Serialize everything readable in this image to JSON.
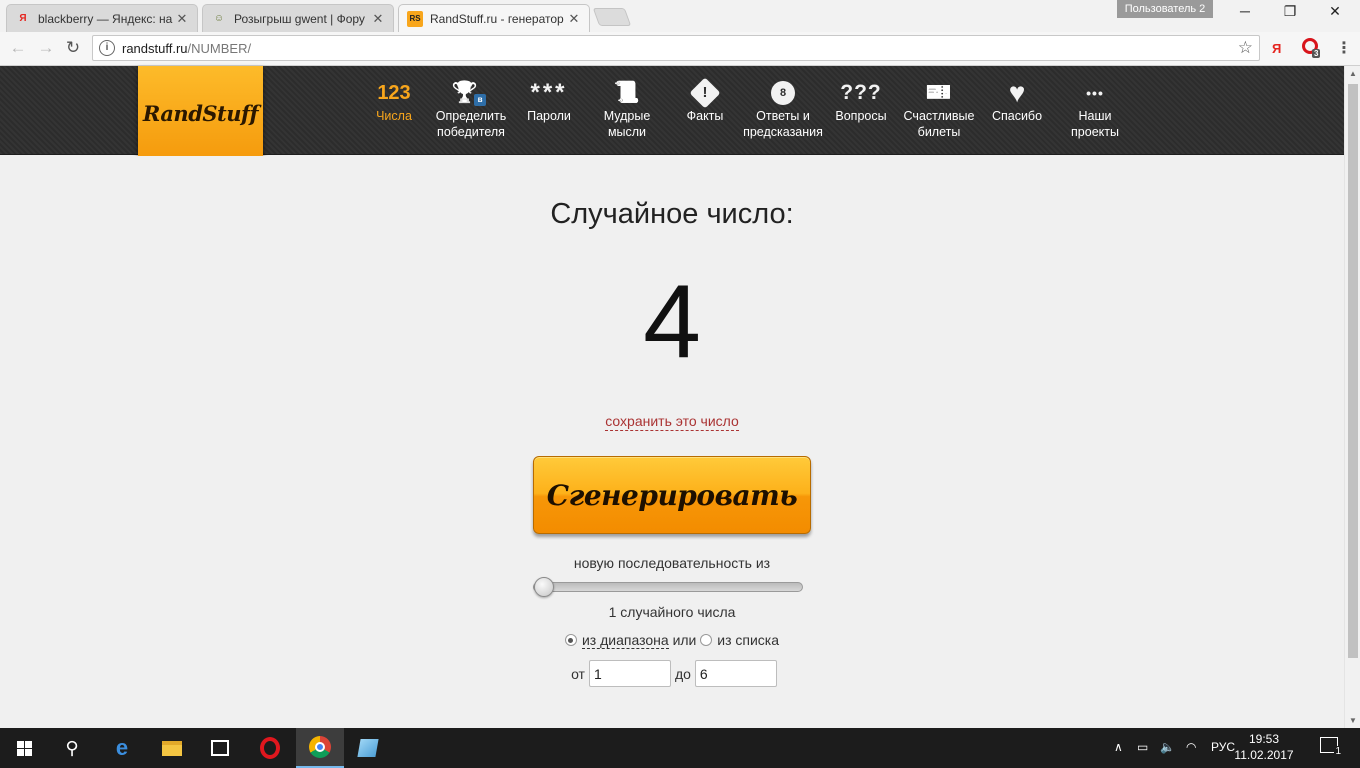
{
  "browser": {
    "tabs": [
      {
        "title": "blackberry — Яндекс: на",
        "favicon": "Я",
        "favicon_color": "#e52620"
      },
      {
        "title": "Розыгрыш gwent | Фору",
        "favicon": "☺",
        "favicon_color": "#6b7b3a"
      },
      {
        "title": "RandStuff.ru - генератор",
        "favicon": "RS",
        "favicon_color": "#f8a61c"
      }
    ],
    "user_badge": "Пользователь 2",
    "url_host": "randstuff.ru",
    "url_path": "/NUMBER/",
    "ext_badge": "3"
  },
  "site": {
    "logo": "RandStuff",
    "nav": [
      {
        "icon": "123",
        "label": "Числа",
        "active": true
      },
      {
        "icon": "🏆",
        "label": "Определить победителя",
        "active": false
      },
      {
        "icon": "***",
        "label": "Пароли",
        "active": false
      },
      {
        "icon": "📜",
        "label": "Мудрые мысли",
        "active": false
      },
      {
        "icon": "❗",
        "label": "Факты",
        "active": false
      },
      {
        "icon": "8",
        "label": "Ответы и предсказания",
        "active": false
      },
      {
        "icon": "???",
        "label": "Вопросы",
        "active": false
      },
      {
        "icon": "🎫",
        "label": "Счастливые билеты",
        "active": false
      },
      {
        "icon": "♥",
        "label": "Спасибо",
        "active": false
      },
      {
        "icon": "•••",
        "label": "Наши проекты",
        "active": false
      }
    ],
    "accent_color": "#f8a61c"
  },
  "main": {
    "title": "Случайное число:",
    "number": "4",
    "save_link": "сохранить это число",
    "generate_button": "Сгенерировать",
    "sequence_label": "новую последовательность из",
    "count_label": "1 случайного числа",
    "slider_value": 1,
    "mode_range": "из диапазона",
    "mode_or": "или",
    "mode_list": "из списка",
    "from_label": "от",
    "from_value": "1",
    "to_label": "до",
    "to_value": "6"
  },
  "taskbar": {
    "lang": "РУС",
    "time": "19:53",
    "date": "11.02.2017",
    "notifications": "1"
  }
}
